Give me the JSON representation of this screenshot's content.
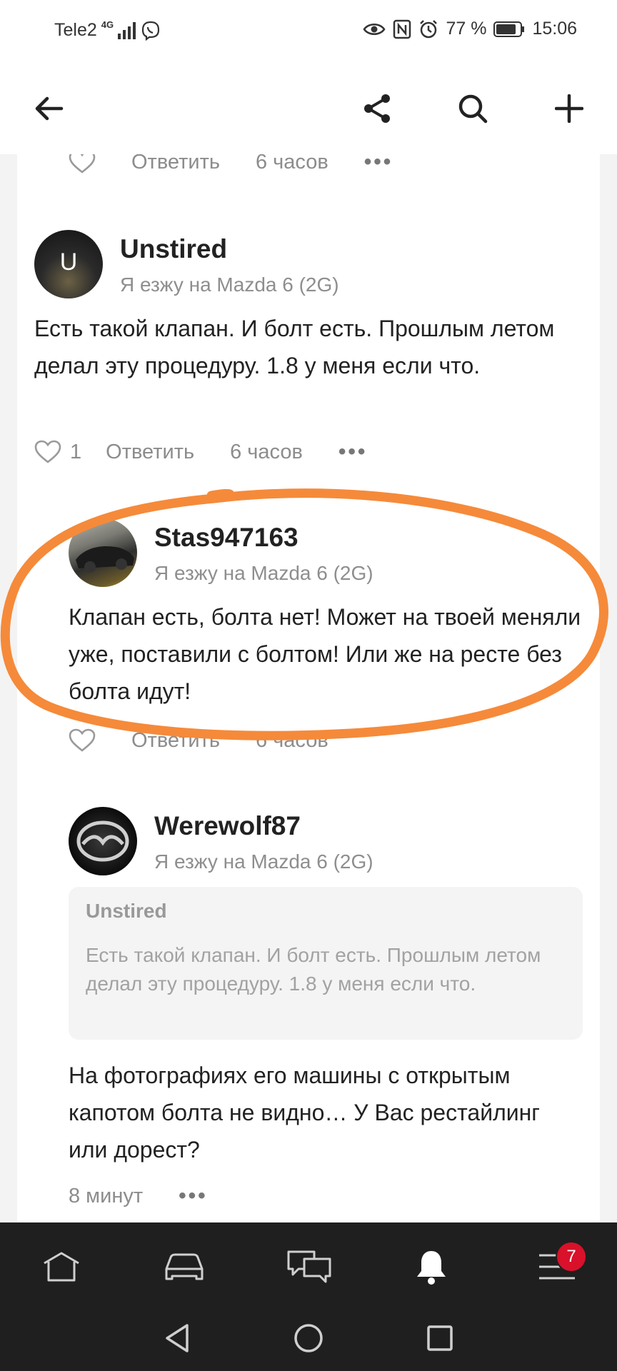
{
  "status_bar": {
    "carrier": "Tele2",
    "network": "4G",
    "battery": "77 %",
    "time": "15:06"
  },
  "app_bar": {
    "icons": [
      "back-arrow-icon",
      "share-icon",
      "search-icon",
      "plus-icon"
    ]
  },
  "top_actions": {
    "reply": "Ответить",
    "time": "6 часов"
  },
  "comments": [
    {
      "username": "Unstired",
      "avatar_letter": "U",
      "car": "Я езжу на Mazda 6 (2G)",
      "text": "Есть такой клапан. И болт есть. Прошлым летом делал эту процедуру. 1.8 у меня если что.",
      "likes": "1",
      "reply": "Ответить",
      "time": "6 часов"
    },
    {
      "username": "Stas947163",
      "car": "Я езжу на Mazda 6 (2G)",
      "text": "Клапан есть, болта нет! Может на твоей меняли уже, поставили с болтом! Или же на ресте без болта идут!",
      "reply": "Ответить",
      "time": "6 часов"
    },
    {
      "username": "Werewolf87",
      "car": "Я езжу на Mazda 6 (2G)",
      "quote": {
        "author": "Unstired",
        "text": "Есть такой клапан. И болт есть. Прошлым летом делал эту процедуру. 1.8 у меня если что."
      },
      "text": "На фотографиях его машины с открытым капотом болта не видно… У Вас рестайлинг или дорест?",
      "time": "8 минут"
    }
  ],
  "bottom_nav": {
    "tabs": [
      "home-icon",
      "car-icon",
      "messages-icon",
      "notifications-icon",
      "menu-icon"
    ],
    "menu_badge": "7"
  },
  "colors": {
    "annotation": "#f58a3a",
    "badge": "#d9112a",
    "nav_background": "#1f1f1f"
  }
}
